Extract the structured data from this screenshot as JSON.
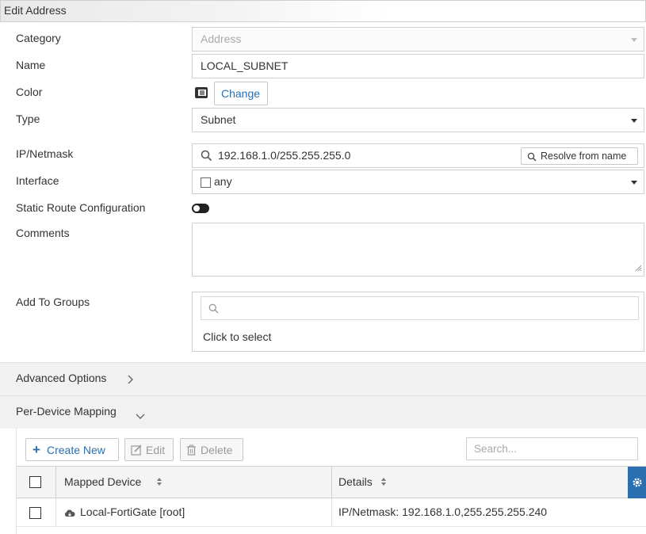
{
  "window": {
    "title": "Edit Address"
  },
  "form": {
    "category": {
      "label": "Category",
      "value": "Address"
    },
    "name": {
      "label": "Name",
      "value": "LOCAL_SUBNET"
    },
    "color": {
      "label": "Color",
      "change_label": "Change"
    },
    "type": {
      "label": "Type",
      "value": "Subnet"
    },
    "ip_netmask": {
      "label": "IP/Netmask",
      "value": "192.168.1.0/255.255.255.0",
      "resolve_label": "Resolve from name"
    },
    "interface": {
      "label": "Interface",
      "value": "any"
    },
    "static_route": {
      "label": "Static Route Configuration",
      "enabled": false
    },
    "comments": {
      "label": "Comments",
      "value": ""
    },
    "add_to_groups": {
      "label": "Add To Groups",
      "search_placeholder": "",
      "click_to_select": "Click to select"
    }
  },
  "sections": {
    "advanced_options": "Advanced Options",
    "per_device_mapping": "Per-Device Mapping"
  },
  "toolbar": {
    "create_new": "Create New",
    "edit": "Edit",
    "delete": "Delete",
    "search_placeholder": "Search..."
  },
  "table": {
    "headers": [
      "Mapped Device",
      "Details"
    ],
    "rows": [
      {
        "device": "Local-FortiGate [root]",
        "details": "IP/Netmask: 192.168.1.0,255.255.255.240"
      }
    ]
  },
  "colors": {
    "link_blue": "#2a6fb0",
    "gear_blue": "#2a6fb0"
  }
}
